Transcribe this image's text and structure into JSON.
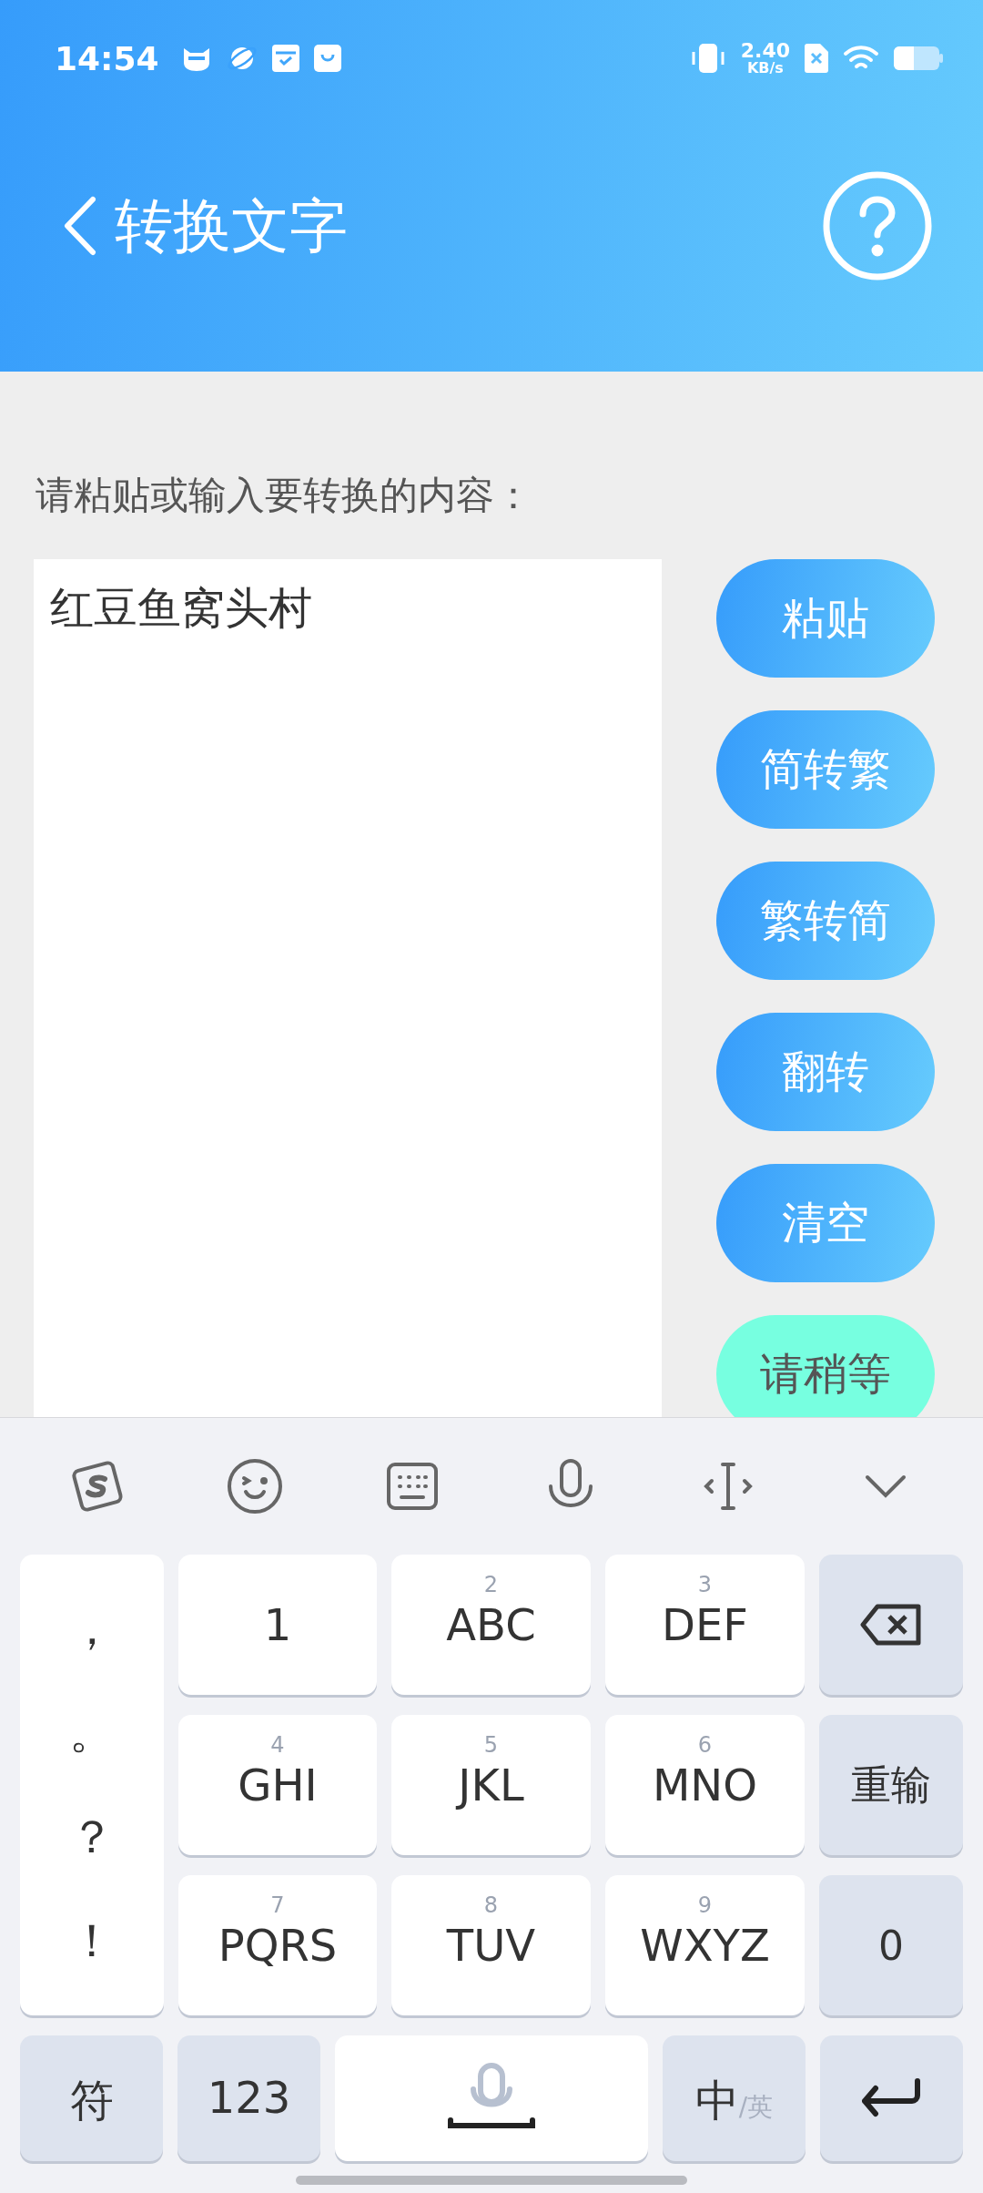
{
  "status_bar": {
    "time": "14:54",
    "speed_value": "2.40",
    "speed_unit": "KB/s"
  },
  "header": {
    "title": "转换文字"
  },
  "prompt": "请粘贴或输入要转换的内容：",
  "editor": {
    "value": "红豆鱼窝头村"
  },
  "actions": [
    {
      "label": "粘贴",
      "kind": "primary"
    },
    {
      "label": "简转繁",
      "kind": "primary"
    },
    {
      "label": "繁转简",
      "kind": "primary"
    },
    {
      "label": "翻转",
      "kind": "primary"
    },
    {
      "label": "清空",
      "kind": "primary"
    },
    {
      "label": "请稍等",
      "kind": "waiting"
    }
  ],
  "keyboard": {
    "punctuation": [
      "，",
      "。",
      "？",
      "！"
    ],
    "digit_key": "1",
    "keys": [
      {
        "kind": "letters",
        "number": "2",
        "letters": "ABC"
      },
      {
        "kind": "letters",
        "number": "3",
        "letters": "DEF"
      },
      {
        "kind": "letters",
        "number": "4",
        "letters": "GHI"
      },
      {
        "kind": "letters",
        "number": "5",
        "letters": "JKL"
      },
      {
        "kind": "letters",
        "number": "6",
        "letters": "MNO"
      },
      {
        "kind": "letters",
        "number": "7",
        "letters": "PQRS"
      },
      {
        "kind": "letters",
        "number": "8",
        "letters": "TUV"
      },
      {
        "kind": "letters",
        "number": "9",
        "letters": "WXYZ"
      }
    ],
    "side_keys": [
      {
        "kind": "backspace"
      },
      {
        "kind": "text",
        "label": "重输"
      },
      {
        "kind": "text",
        "label": "0"
      }
    ],
    "bottom_keys": [
      {
        "kind": "text",
        "label": "符"
      },
      {
        "kind": "text",
        "label": "123"
      },
      {
        "kind": "space"
      },
      {
        "kind": "lang",
        "label": "中",
        "sub": "/英"
      },
      {
        "kind": "enter"
      }
    ]
  }
}
